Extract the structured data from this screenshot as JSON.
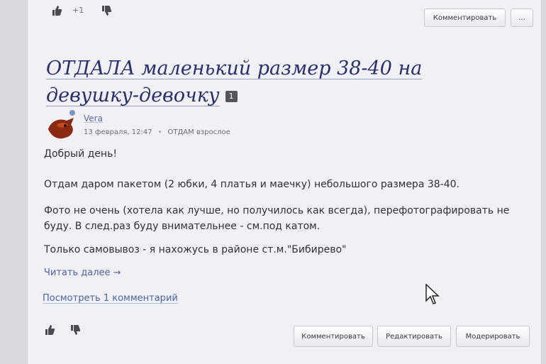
{
  "toolbar_top": {
    "like_icon": "thumbs-up-icon",
    "vote_count": "+1",
    "dislike_icon": "thumbs-down-icon",
    "comment_label": "Комментировать",
    "more_label": "..."
  },
  "post": {
    "title": "ОТДАЛА маленький размер 38-40 на девушку-девочку",
    "comment_badge": "1",
    "author": "Vera",
    "date": "13 февраля, 12:47",
    "category": "ОТДАМ взрослое",
    "paragraphs": [
      "Добрый день!",
      "Отдам даром пакетом (2 юбки, 4 платья и маечку) небольшого размера 38-40.",
      "Фото не очень (хотела как лучше, но получилось как всегда), перефотографировать не буду. В след.раз буду внимательнее - см.под катом.",
      "Только самовывоз - я нахожусь в районе ст.м.\"Бибирево\""
    ],
    "read_more": "Читать далее →",
    "view_comments": "Посмотреть 1 комментарий"
  },
  "toolbar_bottom": {
    "like_icon": "thumbs-up-icon",
    "dislike_icon": "thumbs-down-icon",
    "comment_label": "Комментировать",
    "edit_label": "Редактировать",
    "moderate_label": "Модерировать"
  },
  "colors": {
    "title": "#28306a",
    "link": "#4c63a3",
    "page_bg": "#f1f1f5"
  }
}
